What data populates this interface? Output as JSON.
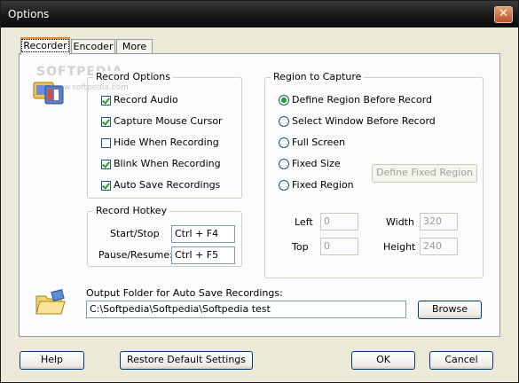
{
  "window": {
    "title": "Options",
    "close_label": "✕"
  },
  "tabs": [
    {
      "label": "Recorder",
      "active": true
    },
    {
      "label": "Encoder",
      "active": false
    },
    {
      "label": "More",
      "active": false
    }
  ],
  "watermark": {
    "main": "SOFTPEDIA",
    "sub": "www.softpedia.com"
  },
  "record_options": {
    "title": "Record Options",
    "items": [
      {
        "label": "Record Audio",
        "checked": true
      },
      {
        "label": "Capture Mouse Cursor",
        "checked": true
      },
      {
        "label": "Hide When Recording",
        "checked": false
      },
      {
        "label": "Blink When Recording",
        "checked": true
      },
      {
        "label": "Auto Save Recordings",
        "checked": true
      }
    ]
  },
  "record_hotkey": {
    "title": "Record Hotkey",
    "start_stop_label": "Start/Stop",
    "start_stop_value": "Ctrl + F4",
    "pause_resume_label": "Pause/Resume:",
    "pause_resume_value": "Ctrl + F5"
  },
  "region": {
    "title": "Region to Capture",
    "options": [
      {
        "label": "Define Region Before Record",
        "selected": true
      },
      {
        "label": "Select Window Before Record",
        "selected": false
      },
      {
        "label": "Full Screen",
        "selected": false
      },
      {
        "label": "Fixed Size",
        "selected": false
      },
      {
        "label": "Fixed Region",
        "selected": false
      }
    ],
    "define_fixed_button": "Define Fixed Region",
    "left_label": "Left",
    "left_value": "0",
    "top_label": "Top",
    "top_value": "0",
    "width_label": "Width",
    "width_value": "320",
    "height_label": "Height",
    "height_value": "240"
  },
  "output": {
    "label": "Output Folder for Auto Save Recordings:",
    "path": "C:\\Softpedia\\Softpedia\\Softpedia test",
    "browse_label": "Browse"
  },
  "footer": {
    "help": "Help",
    "restore": "Restore Default Settings",
    "ok": "OK",
    "cancel": "Cancel"
  },
  "colors": {
    "accent_check": "#21a121",
    "tab_highlight": "#e68b2c",
    "titlebar": "#161616"
  }
}
